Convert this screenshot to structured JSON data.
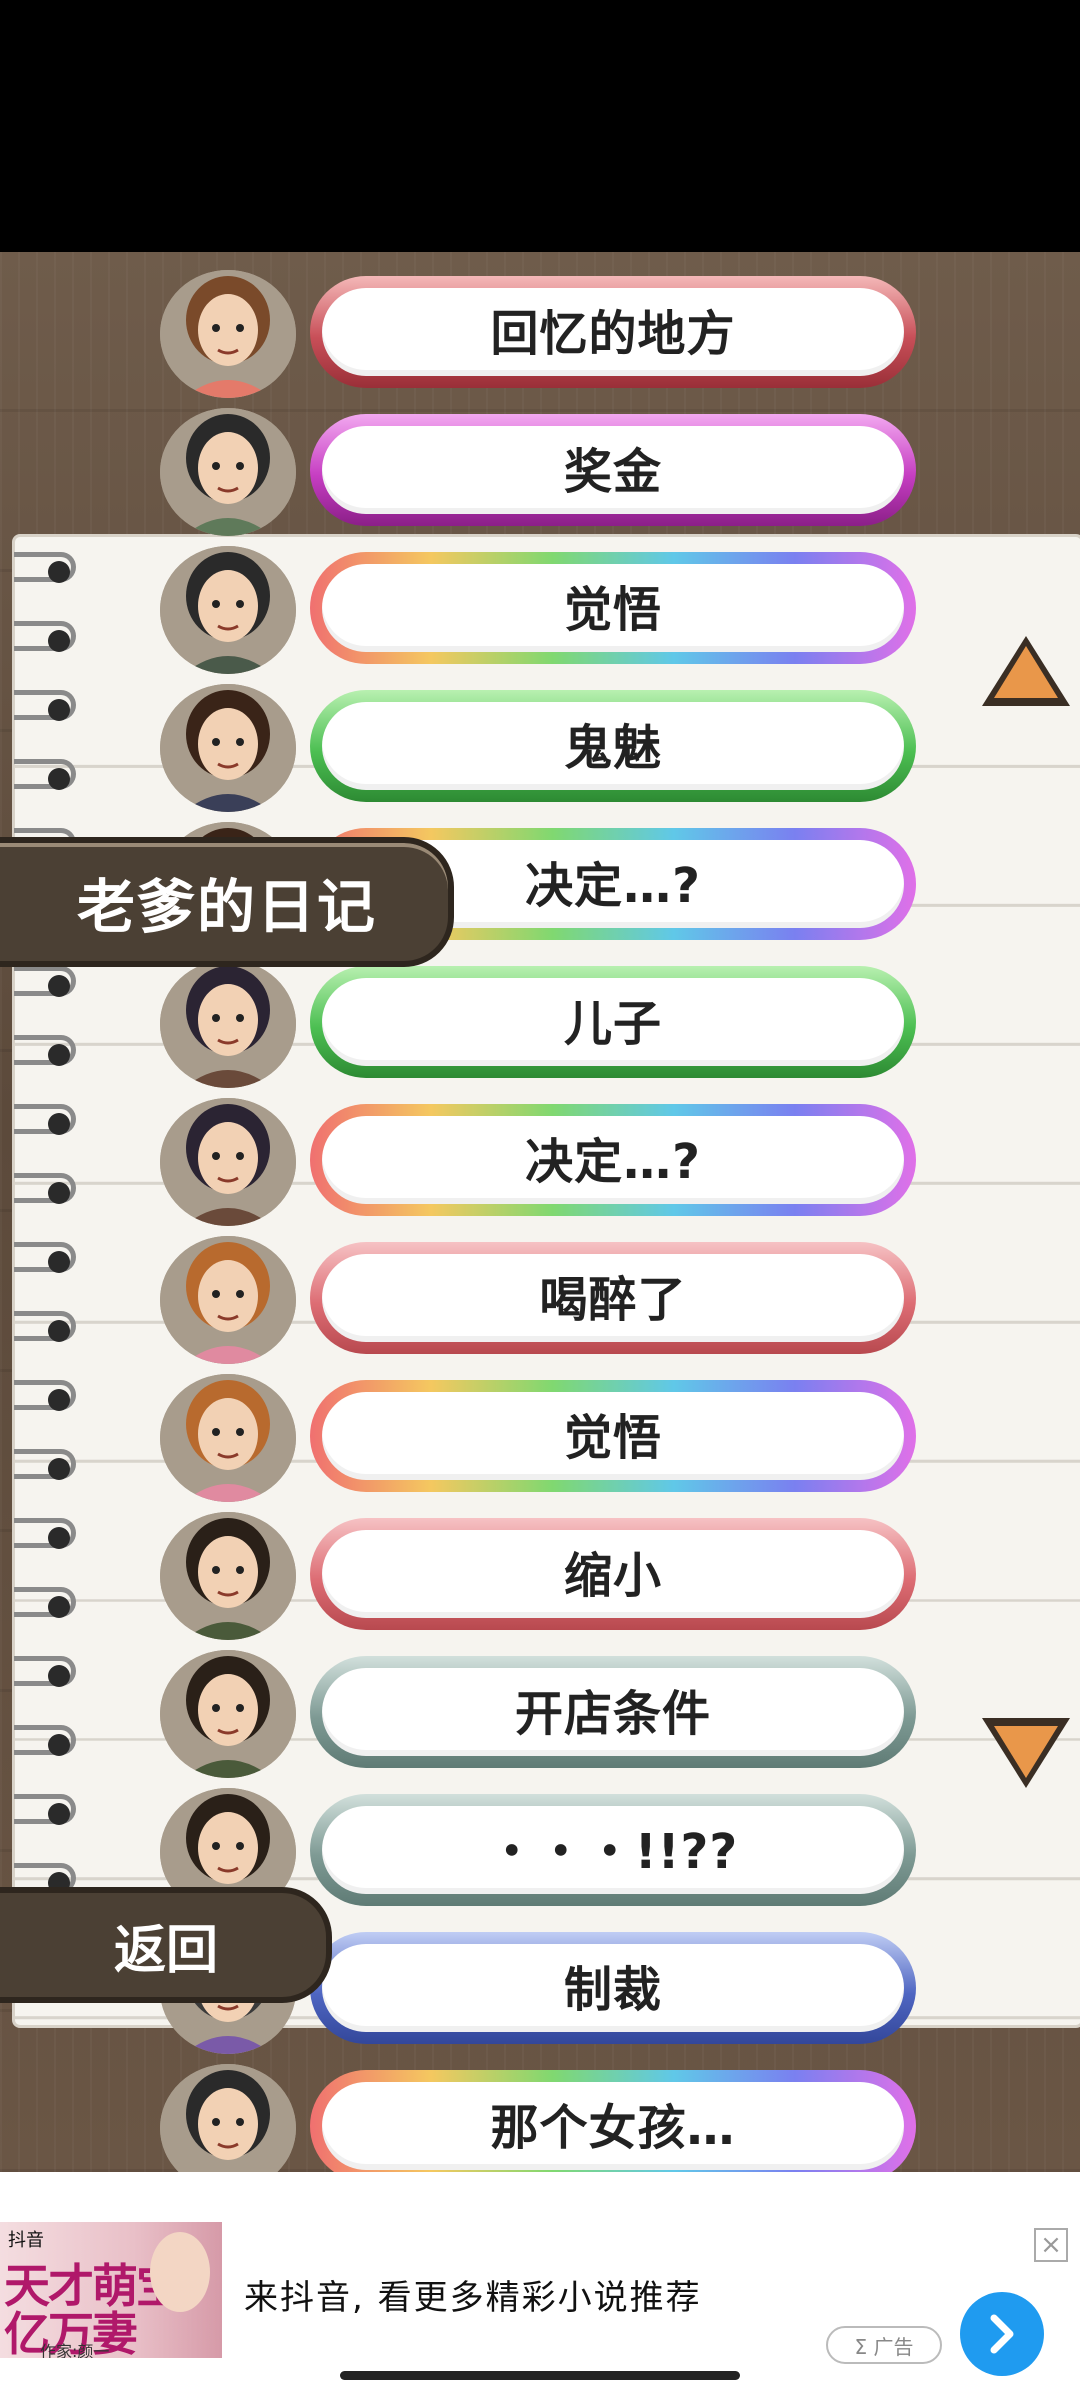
{
  "screen": {
    "title": "老爹的日记",
    "back_label": "返回"
  },
  "entries": [
    {
      "label": "回忆的地方",
      "border": "red"
    },
    {
      "label": "奖金",
      "border": "magenta"
    },
    {
      "label": "觉悟",
      "border": "rainbow"
    },
    {
      "label": "鬼魅",
      "border": "green"
    },
    {
      "label": "决定…?",
      "border": "rainbow"
    },
    {
      "label": "儿子",
      "border": "green"
    },
    {
      "label": "决定…?",
      "border": "rainbow"
    },
    {
      "label": "喝醉了",
      "border": "pink"
    },
    {
      "label": "觉悟",
      "border": "rainbow"
    },
    {
      "label": "缩小",
      "border": "pink"
    },
    {
      "label": "开店条件",
      "border": "teal"
    },
    {
      "label": "・・・!!??",
      "border": "teal"
    },
    {
      "label": "制裁",
      "border": "blue"
    },
    {
      "label": "那个女孩…",
      "border": "rainbow"
    }
  ],
  "scroll": {
    "up_icon": "triangle-up-icon",
    "down_icon": "triangle-down-icon",
    "color": "#e9974a"
  },
  "ad": {
    "thumb_brand": "抖音",
    "thumb_line1": "天才萌宝",
    "thumb_line2": "亿万妻",
    "thumb_author": "作家:颜一",
    "text": "来抖音, 看更多精彩小说推荐",
    "badge": "Σ 广告",
    "close_icon": "close-icon",
    "go_icon": "chevron-right-icon"
  },
  "colors": {
    "wood": "#5c4a3b",
    "tab": "#4b4034",
    "paper": "#f6f4ef"
  }
}
